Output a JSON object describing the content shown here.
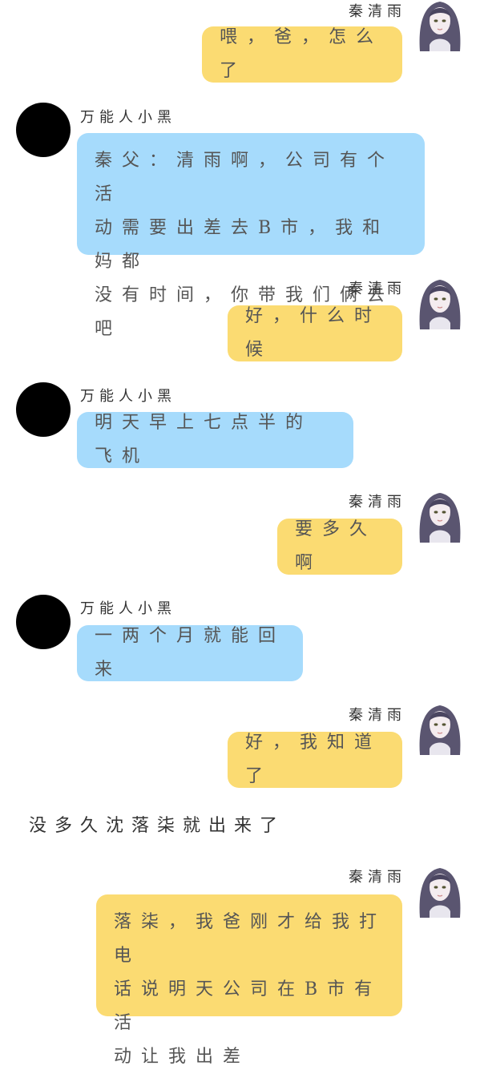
{
  "chat": {
    "messages": [
      {
        "side": "right",
        "sender": "秦清雨",
        "text": "喂，爸，怎么了"
      },
      {
        "side": "left",
        "sender": "万能人小黑",
        "lines": [
          "秦父：清雨啊，公司有个活",
          "动需要出差去B市，我和妈都",
          "没有时间，你带我们俩去吧"
        ]
      },
      {
        "side": "right",
        "sender": "秦清雨",
        "text": "好，什么时候"
      },
      {
        "side": "left",
        "sender": "万能人小黑",
        "text": "明天早上七点半的飞机"
      },
      {
        "side": "right",
        "sender": "秦清雨",
        "text": "要多久啊"
      },
      {
        "side": "left",
        "sender": "万能人小黑",
        "text": "一两个月就能回来"
      },
      {
        "side": "right",
        "sender": "秦清雨",
        "text": "好，我知道了"
      },
      {
        "side": "narration",
        "text": "没多久沈落柒就出来了"
      },
      {
        "side": "right",
        "sender": "秦清雨",
        "lines": [
          "落柒，我爸刚才给我打电",
          "话说明天公司在B市有活",
          "动让我出差"
        ]
      }
    ]
  },
  "colors": {
    "right_bubble": "#fbdb72",
    "left_bubble": "#a6dbfc",
    "left_avatar": "#000000"
  }
}
